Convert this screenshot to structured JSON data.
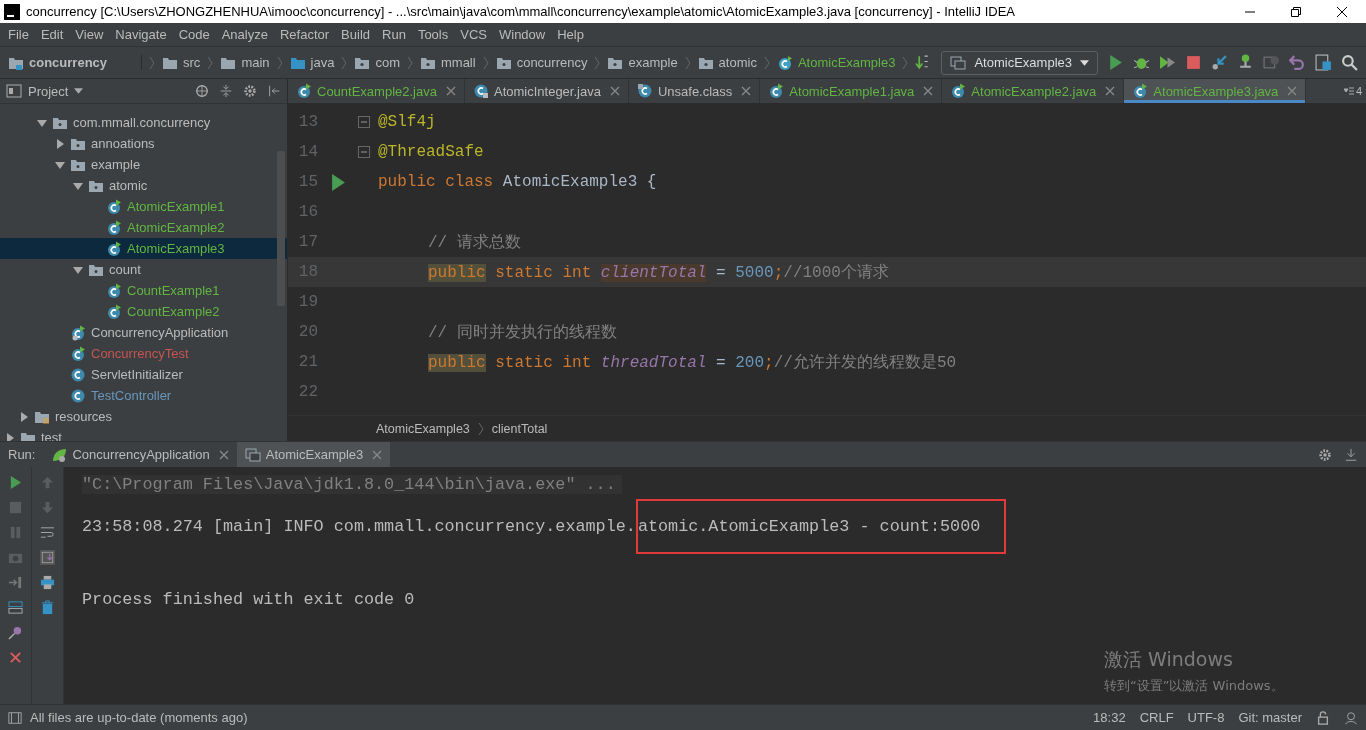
{
  "title_bar": {
    "title": "concurrency [C:\\Users\\ZHONGZHENHUA\\imooc\\concurrency] - ...\\src\\main\\java\\com\\mmall\\concurrency\\example\\atomic\\AtomicExample3.java [concurrency] - IntelliJ IDEA"
  },
  "menu": [
    "File",
    "Edit",
    "View",
    "Navigate",
    "Code",
    "Analyze",
    "Refactor",
    "Build",
    "Run",
    "Tools",
    "VCS",
    "Window",
    "Help"
  ],
  "nav_bar": {
    "crumbs": [
      {
        "label": "concurrency",
        "kind": "project"
      },
      {
        "label": "src",
        "kind": "folder"
      },
      {
        "label": "main",
        "kind": "folder"
      },
      {
        "label": "java",
        "kind": "source"
      },
      {
        "label": "com",
        "kind": "package"
      },
      {
        "label": "mmall",
        "kind": "package"
      },
      {
        "label": "concurrency",
        "kind": "package"
      },
      {
        "label": "example",
        "kind": "package"
      },
      {
        "label": "atomic",
        "kind": "package"
      },
      {
        "label": "AtomicExample3",
        "kind": "class"
      }
    ],
    "run_config": "AtomicExample3"
  },
  "project_panel": {
    "title": "Project",
    "tree": [
      {
        "children": [
          {
            "children": [
              {
                "label": "com.mmall.concurrency",
                "kind": "package",
                "expanded": true,
                "selected": false,
                "color": "#bbbbbb",
                "children": [
                  {
                    "label": "annoations",
                    "kind": "package",
                    "expanded": false,
                    "selected": false,
                    "color": "#bbbbbb"
                  },
                  {
                    "label": "example",
                    "kind": "package",
                    "expanded": true,
                    "selected": false,
                    "color": "#bbbbbb",
                    "children": [
                      {
                        "label": "atomic",
                        "kind": "package",
                        "expanded": true,
                        "selected": false,
                        "color": "#bbbbbb",
                        "children": [
                          {
                            "label": "AtomicExample1",
                            "kind": "runnable",
                            "selected": false,
                            "color": "#62b543"
                          },
                          {
                            "label": "AtomicExample2",
                            "kind": "runnable",
                            "selected": false,
                            "color": "#62b543"
                          },
                          {
                            "label": "AtomicExample3",
                            "kind": "runnable",
                            "selected": true,
                            "color": "#62b543"
                          }
                        ]
                      },
                      {
                        "label": "count",
                        "kind": "package",
                        "expanded": true,
                        "selected": false,
                        "color": "#bbbbbb",
                        "children": [
                          {
                            "label": "CountExample1",
                            "kind": "runnable",
                            "selected": false,
                            "color": "#62b543"
                          },
                          {
                            "label": "CountExample2",
                            "kind": "runnable",
                            "selected": false,
                            "color": "#62b543"
                          }
                        ]
                      }
                    ]
                  },
                  {
                    "label": "ConcurrencyApplication",
                    "kind": "spring",
                    "selected": false,
                    "color": "#bbbbbb"
                  },
                  {
                    "label": "ConcurrencyTest",
                    "kind": "runnable",
                    "selected": false,
                    "color": "#c75450"
                  },
                  {
                    "label": "ServletInitializer",
                    "kind": "class",
                    "selected": false,
                    "color": "#bbbbbb"
                  },
                  {
                    "label": "TestController",
                    "kind": "class",
                    "selected": false,
                    "color": "#6897bb"
                  }
                ]
              }
            ]
          },
          {
            "label": "resources",
            "kind": "resources",
            "expanded": false,
            "selected": false,
            "color": "#bbbbbb"
          }
        ]
      },
      {
        "label": "test",
        "kind": "folder",
        "expanded": false,
        "selected": false,
        "color": "#bbbbbb"
      }
    ]
  },
  "editor_tabs": [
    {
      "label": "CountExample2.java",
      "kind": "runnable",
      "selected": false,
      "color": "#62b543"
    },
    {
      "label": "AtomicInteger.java",
      "kind": "class",
      "selected": false,
      "color": "#bbbbbb"
    },
    {
      "label": "Unsafe.class",
      "kind": "compiled",
      "selected": false,
      "color": "#bbbbbb"
    },
    {
      "label": "AtomicExample1.java",
      "kind": "runnable",
      "selected": false,
      "color": "#62b543"
    },
    {
      "label": "AtomicExample2.java",
      "kind": "runnable",
      "selected": false,
      "color": "#62b543"
    },
    {
      "label": "AtomicExample3.java",
      "kind": "runnable",
      "selected": true,
      "color": "#62b543"
    }
  ],
  "tab_overflow_count": "4",
  "code_lines": [
    {
      "number": "13",
      "fold": true,
      "run_marker": false,
      "current": false,
      "tokens": [
        {
          "text": "@Slf4j",
          "kind": "annotation",
          "highlight": false
        }
      ]
    },
    {
      "number": "14",
      "fold": true,
      "run_marker": false,
      "current": false,
      "tokens": [
        {
          "text": "@ThreadSafe",
          "kind": "annotation",
          "highlight": false
        }
      ]
    },
    {
      "number": "15",
      "fold": false,
      "run_marker": true,
      "current": false,
      "tokens": [
        {
          "text": "public class ",
          "kind": "keyword",
          "highlight": false
        },
        {
          "text": "AtomicExample3 {",
          "kind": "plain",
          "highlight": false
        }
      ],
      "children": [
        {
          "number": "16",
          "fold": false,
          "run_marker": false,
          "current": false
        },
        {
          "number": "17",
          "fold": false,
          "run_marker": false,
          "current": false,
          "tokens": [
            {
              "text": "// 请求总数",
              "kind": "comment",
              "highlight": false
            }
          ]
        },
        {
          "number": "18",
          "fold": false,
          "run_marker": false,
          "current": true,
          "tokens": [
            {
              "text": "public",
              "kind": "keyword",
              "highlight": true
            },
            {
              "text": " static int ",
              "kind": "keyword",
              "highlight": false
            },
            {
              "text": "clientTotal",
              "kind": "field",
              "highlight": true
            },
            {
              "text": " = ",
              "kind": "plain",
              "highlight": false
            },
            {
              "text": "5000",
              "kind": "number",
              "highlight": false
            },
            {
              "text": ";",
              "kind": "keyword",
              "highlight": false
            },
            {
              "text": "//1000个请求",
              "kind": "comment",
              "highlight": false
            }
          ]
        },
        {
          "number": "19",
          "fold": false,
          "run_marker": false,
          "current": false
        },
        {
          "number": "20",
          "fold": false,
          "run_marker": false,
          "current": false,
          "tokens": [
            {
              "text": "// 同时并发执行的线程数",
              "kind": "comment",
              "highlight": false
            }
          ]
        },
        {
          "number": "21",
          "fold": false,
          "run_marker": false,
          "current": false,
          "tokens": [
            {
              "text": "public",
              "kind": "keyword",
              "highlight": true
            },
            {
              "text": " static int ",
              "kind": "keyword",
              "highlight": false
            },
            {
              "text": "threadTotal",
              "kind": "field",
              "highlight": false
            },
            {
              "text": " = ",
              "kind": "plain",
              "highlight": false
            },
            {
              "text": "200",
              "kind": "number",
              "highlight": false
            },
            {
              "text": ";",
              "kind": "keyword",
              "highlight": false
            },
            {
              "text": "//允许并发的线程数是50",
              "kind": "comment",
              "highlight": false
            }
          ]
        },
        {
          "number": "22",
          "fold": false,
          "run_marker": false,
          "current": false
        }
      ]
    }
  ],
  "editor_breadcrumbs": [
    "AtomicExample3",
    "clientTotal"
  ],
  "run_panel": {
    "label": "Run:",
    "tabs": [
      {
        "label": "ConcurrencyApplication",
        "kind": "spring",
        "selected": false
      },
      {
        "label": "AtomicExample3",
        "kind": "app",
        "selected": true
      }
    ],
    "console": [
      {
        "kind": "command",
        "segments": [
          {
            "text": "\"C:\\Program Files\\Java\\jdk1.8.0_144\\bin\\java.exe\" ...",
            "boxed": false
          }
        ]
      },
      {
        "kind": "output",
        "segments": [
          {
            "text": "23:58:08.274 [main] INFO com.mmall.concurrency.example.",
            "boxed": false
          },
          {
            "text": "atomic.AtomicExample3 - count:5000",
            "boxed": true
          }
        ]
      },
      {
        "kind": "blank"
      },
      {
        "kind": "output",
        "segments": [
          {
            "text": "Process finished with exit code 0",
            "boxed": false
          }
        ]
      }
    ]
  },
  "os_notice": {
    "title": "激活 Windows",
    "message": "转到“设置”以激活 Windows。"
  },
  "status_bar": {
    "message": "All files are up-to-date (moments ago)",
    "items": [
      "18:32",
      "CRLF",
      "UTF-8",
      "Git: master"
    ]
  }
}
